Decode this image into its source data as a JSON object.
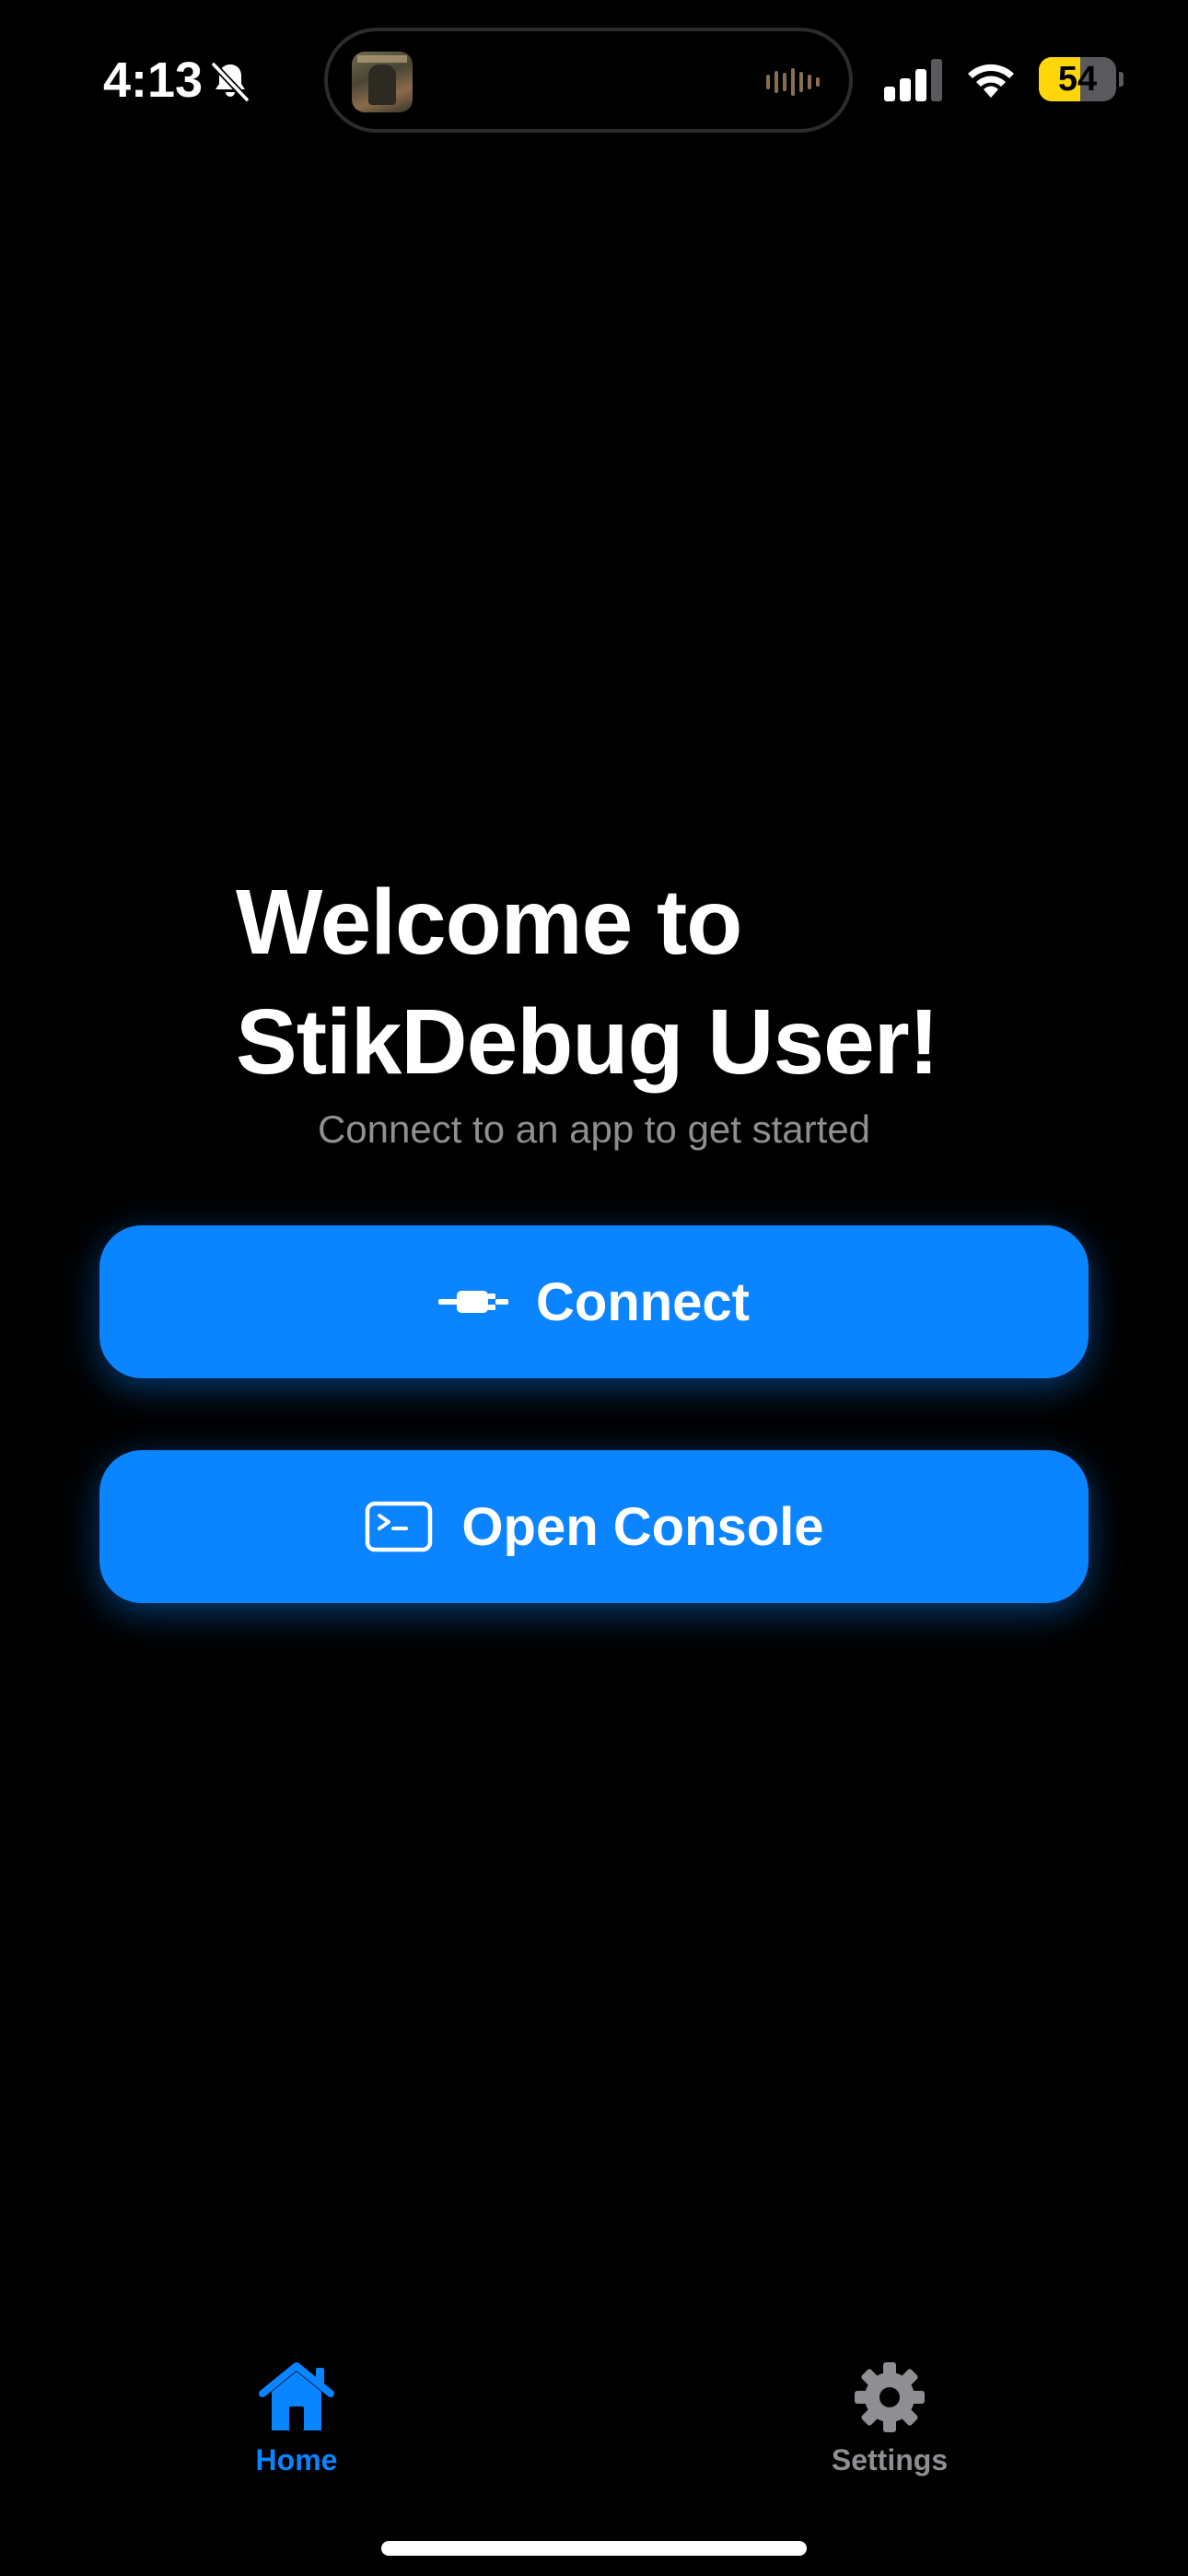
{
  "status_bar": {
    "time": "4:13",
    "battery_level": "54",
    "battery_fraction": 0.54,
    "battery_color": "#ffd60a",
    "icons": [
      "bell-slash-icon",
      "waveform-icon",
      "cellular-signal-icon",
      "wifi-icon",
      "battery-icon"
    ]
  },
  "welcome": {
    "title_line_1": "Welcome to",
    "title_line_2": "StikDebug User!",
    "subtitle": "Connect to an app to get started"
  },
  "buttons": {
    "connect": {
      "label": "Connect",
      "icon": "cable-connector-icon"
    },
    "console": {
      "label": "Open Console",
      "icon": "terminal-icon"
    }
  },
  "tab_bar": {
    "tabs": [
      {
        "label": "Home",
        "icon": "house-icon",
        "selected": true
      },
      {
        "label": "Settings",
        "icon": "gear-icon",
        "selected": false
      }
    ]
  },
  "colors": {
    "accent": "#0a84ff",
    "background": "#000000",
    "secondary_text": "#8e8e93"
  }
}
